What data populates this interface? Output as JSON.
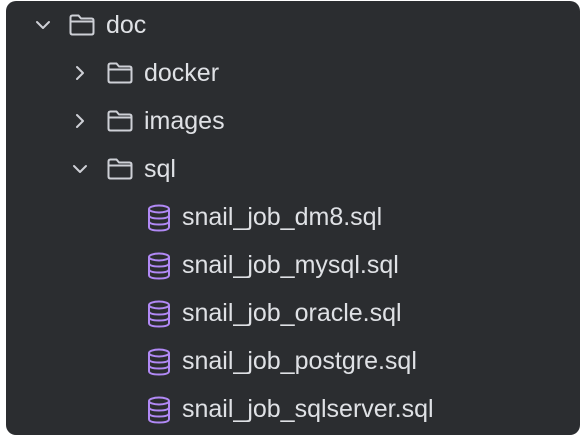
{
  "tree": {
    "root": {
      "label": "doc",
      "icon": "folder-icon",
      "expanded": true
    },
    "folders": [
      {
        "label": "docker",
        "icon": "folder-icon",
        "expanded": false
      },
      {
        "label": "images",
        "icon": "folder-icon",
        "expanded": false
      },
      {
        "label": "sql",
        "icon": "folder-icon",
        "expanded": true
      }
    ],
    "files": [
      {
        "label": "snail_job_dm8.sql",
        "icon": "database-icon"
      },
      {
        "label": "snail_job_mysql.sql",
        "icon": "database-icon"
      },
      {
        "label": "snail_job_oracle.sql",
        "icon": "database-icon"
      },
      {
        "label": "snail_job_postgre.sql",
        "icon": "database-icon"
      },
      {
        "label": "snail_job_sqlserver.sql",
        "icon": "database-icon"
      }
    ]
  },
  "colors": {
    "background": "#2b2d30",
    "text": "#dfe1e5",
    "icon_stroke": "#ced0d6",
    "database_icon": "#b189f5"
  }
}
